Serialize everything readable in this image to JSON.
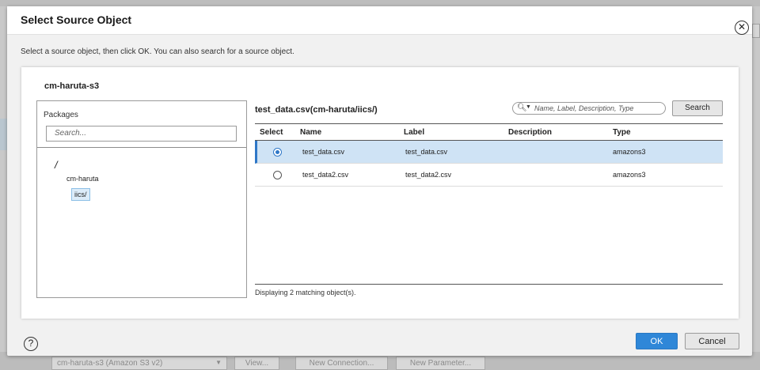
{
  "dialog": {
    "title": "Select Source Object",
    "instruction": "Select a source object, then click OK. You can also search for a source object.",
    "connection_name": "cm-haruta-s3",
    "ok_label": "OK",
    "cancel_label": "Cancel"
  },
  "packages": {
    "label": "Packages",
    "search_placeholder": "Search...",
    "tree": {
      "root": "/",
      "node": "cm-haruta",
      "leaf": "iics/"
    }
  },
  "objects": {
    "title": "test_data.csv(cm-haruta/iics/)",
    "search_placeholder": "Name, Label, Description, Type",
    "search_button": "Search",
    "columns": [
      "Select",
      "Name",
      "Label",
      "Description",
      "Type"
    ],
    "rows": [
      {
        "name": "test_data.csv",
        "label": "test_data.csv",
        "description": "",
        "type": "amazons3",
        "selected": true
      },
      {
        "name": "test_data2.csv",
        "label": "test_data2.csv",
        "description": "",
        "type": "amazons3",
        "selected": false
      }
    ],
    "match_count_text": "Displaying 2 matching object(s)."
  },
  "background": {
    "connection_select": "cm-haruta-s3 (Amazon S3 v2)",
    "view_button": "View...",
    "new_connection_button": "New Connection...",
    "new_parameter_button": "New Parameter..."
  },
  "colors": {
    "primary": "#2f87d8",
    "selected_row": "#cfe3f5"
  },
  "icons": {
    "close": "close-icon",
    "help": "help-icon",
    "search": "search-icon"
  }
}
